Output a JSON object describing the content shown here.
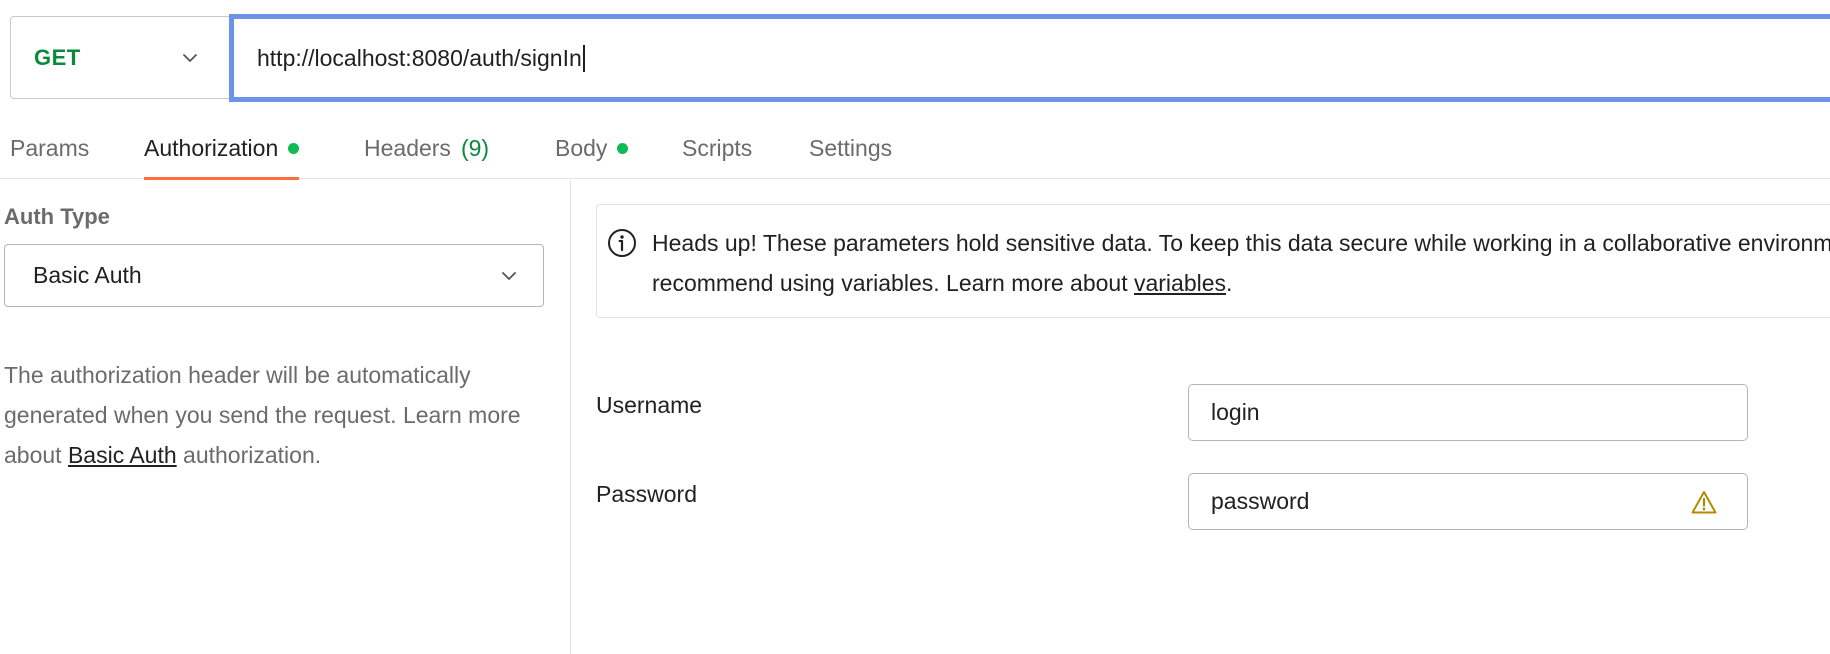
{
  "request": {
    "method": "GET",
    "url": "http://localhost:8080/auth/signIn"
  },
  "tabs": [
    {
      "label": "Params"
    },
    {
      "label": "Authorization",
      "indicator": "green-dot",
      "active": true
    },
    {
      "label": "Headers",
      "count": "(9)"
    },
    {
      "label": "Body",
      "indicator": "green-dot"
    },
    {
      "label": "Scripts"
    },
    {
      "label": "Settings"
    }
  ],
  "auth": {
    "type_label": "Auth Type",
    "type_value": "Basic Auth",
    "desc_before": "The authorization header will be automatically generated when you send the request. Learn more about ",
    "desc_link": "Basic Auth",
    "desc_after": " authorization."
  },
  "notice": {
    "icon": "info-circle-icon",
    "text_before": "Heads up! These parameters hold sensitive data. To keep this data secure while working in a collaborative environment, we recommend using variables. Learn more about ",
    "link": "variables",
    "text_after": "."
  },
  "fields": {
    "username": {
      "label": "Username",
      "value": "login"
    },
    "password": {
      "label": "Password",
      "value": "password",
      "warning_icon": "warning-triangle-icon"
    }
  },
  "colors": {
    "method_get": "#0b8a3e",
    "url_focus_border": "#6d92ea",
    "active_tab_underline": "#ff6c37",
    "indicator_dot": "#0cbb52",
    "warning": "#b58a00"
  }
}
